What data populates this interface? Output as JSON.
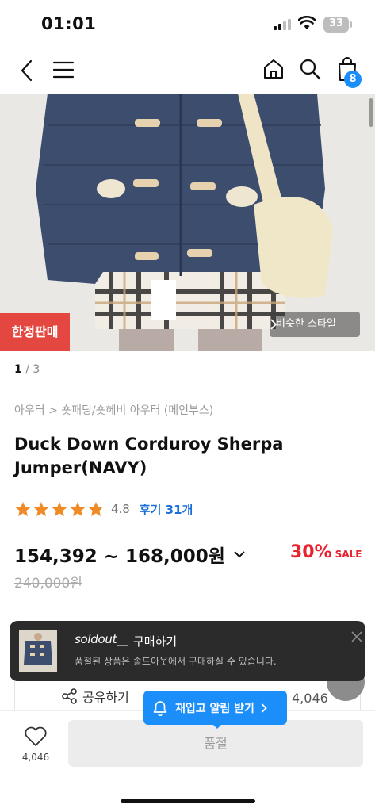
{
  "status_bar": {
    "time": "01:01",
    "battery": "33"
  },
  "nav": {
    "cart_count": "8"
  },
  "hero": {
    "limited_badge": "한정판매",
    "similar_style": "비슷한 스타일",
    "page_current": "1",
    "page_sep": " / ",
    "page_total": "3"
  },
  "product": {
    "breadcrumb": "아우터 > 숏패딩/숏헤비 아우터 (메인부스)",
    "title": "Duck Down Corduroy Sherpa Jumper(NAVY)",
    "rating": 4.8,
    "rating_text": "4.8",
    "reviews": "후기 31개",
    "price_range": "154,392 ~ 168,000원",
    "discount_pct": "30%",
    "discount_label": "SALE",
    "original_price": "240,000원"
  },
  "toast": {
    "brand": "soldout__",
    "action": "구매하기",
    "description": "품절된 상품은 솔드아웃에서 구매하실 수 있습니다."
  },
  "actions": {
    "share": "공유하기",
    "like_count": "4,046",
    "restock_alert": "재입고 알림 받기",
    "soldout_button": "품절"
  },
  "colors": {
    "accent_blue": "#1c8ef9",
    "sale_red": "#e8222e",
    "badge_red": "#e4473f",
    "star": "#f08a24"
  }
}
